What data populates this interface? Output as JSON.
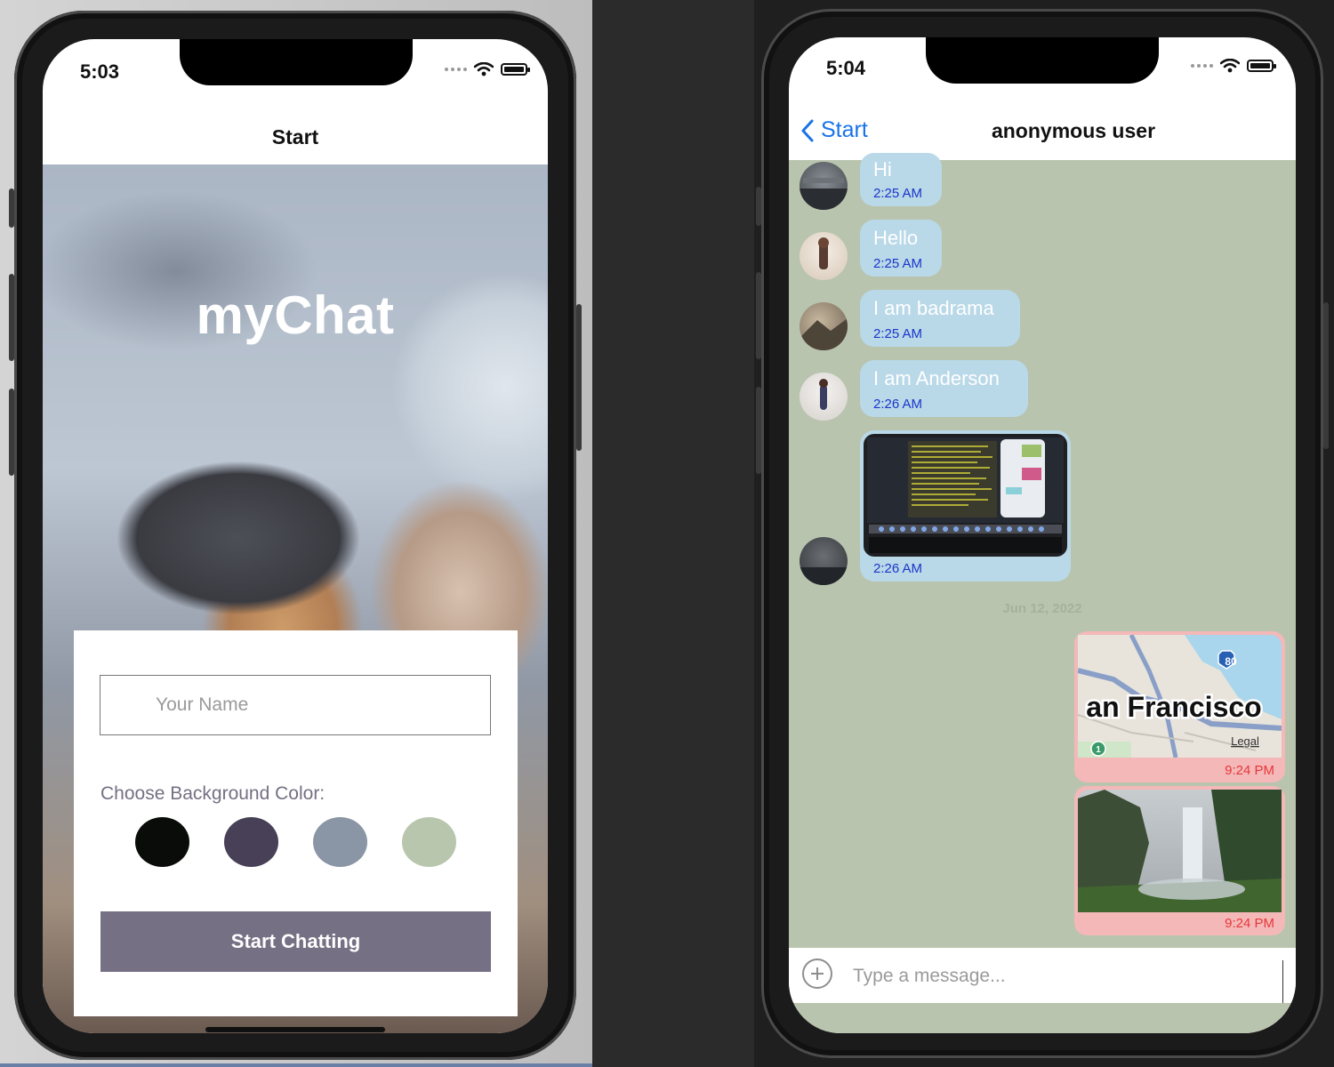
{
  "left_phone": {
    "status_time": "5:03",
    "nav_title": "Start",
    "app_title": "myChat",
    "name_placeholder": "Your Name",
    "color_label": "Choose Background Color:",
    "colors": [
      "#090C08",
      "#474056",
      "#8A95A5",
      "#B9C6AE"
    ],
    "start_button": "Start Chatting"
  },
  "right_phone": {
    "status_time": "5:04",
    "back_label": "Start",
    "chat_title": "anonymous user",
    "chat_background": "#B9C6AE",
    "messages": [
      {
        "text": "Hi",
        "time": "2:25 AM"
      },
      {
        "text": "Hello",
        "time": "2:25 AM"
      },
      {
        "text": "I am badrama",
        "time": "2:25 AM"
      },
      {
        "text": "I am Anderson",
        "time": "2:26 AM"
      },
      {
        "text": "",
        "time": "2:26 AM",
        "kind": "image"
      }
    ],
    "date_separator": "Jun 12, 2022",
    "outgoing": [
      {
        "kind": "map",
        "map_label": "an Francisco",
        "map_legal": "Legal",
        "highway": "80",
        "marker": "1",
        "time": "9:24 PM"
      },
      {
        "kind": "image",
        "time": "9:24 PM"
      }
    ],
    "input_placeholder": "Type a message..."
  }
}
